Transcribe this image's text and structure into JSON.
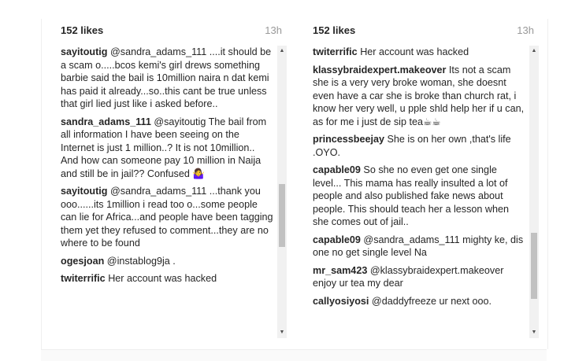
{
  "left_panel": {
    "likes": "152 likes",
    "time": "13h",
    "comments": [
      {
        "user": "sayitoutig",
        "text": "@sandra_adams_111 ....it should be a scam o.....bcos kemi's girl drews something barbie said the bail is 10million naira n dat kemi has paid it already...so..this cant be true unless that girl lied just like i asked before.."
      },
      {
        "user": "sandra_adams_111",
        "text": "@sayitoutig The bail from all information I have been seeing on the Internet is just 1 million..? It is not 10million.. And how can someone pay 10 million in Naija and still be in jail?? Confused 🤷‍♀"
      },
      {
        "user": "sayitoutig",
        "text": "@sandra_adams_111 ...thank you ooo......its 1million i read too o...some people can lie for Africa...and people have been tagging them yet they refused to comment...they are no where to be found"
      },
      {
        "user": "ogesjoan",
        "text": "@instablog9ja ."
      },
      {
        "user": "twiterrific",
        "text": "Her account was hacked"
      }
    ]
  },
  "right_panel": {
    "likes": "152 likes",
    "time": "13h",
    "comments": [
      {
        "user": "twiterrific",
        "text": "Her account was hacked"
      },
      {
        "user": "klassybraidexpert.makeover",
        "text": "Its not a scam she is a very very broke woman, she doesnt even have a car she is broke than church rat, i know her very well, u pple shld help her if u can, as for me i just de sip tea☕☕"
      },
      {
        "user": "princessbeejay",
        "text": "She is on her own ,that's life .OYO."
      },
      {
        "user": "capable09",
        "text": "So she no even get one single level... This mama has really insulted a lot of people and also published fake news about people. This should teach her a lesson when she comes out of jail.."
      },
      {
        "user": "capable09",
        "text": "@sandra_adams_111 mighty ke, dis one no get single level Na"
      },
      {
        "user": "mr_sam423",
        "text": "@klassybraidexpert.makeover enjoy ur tea my dear"
      },
      {
        "user": "callyosiyosi",
        "text": "@daddyfreeze ur next ooo."
      }
    ]
  },
  "icons": {
    "scroll_up": "scroll-up-arrow-icon",
    "scroll_down": "scroll-down-arrow-icon"
  }
}
